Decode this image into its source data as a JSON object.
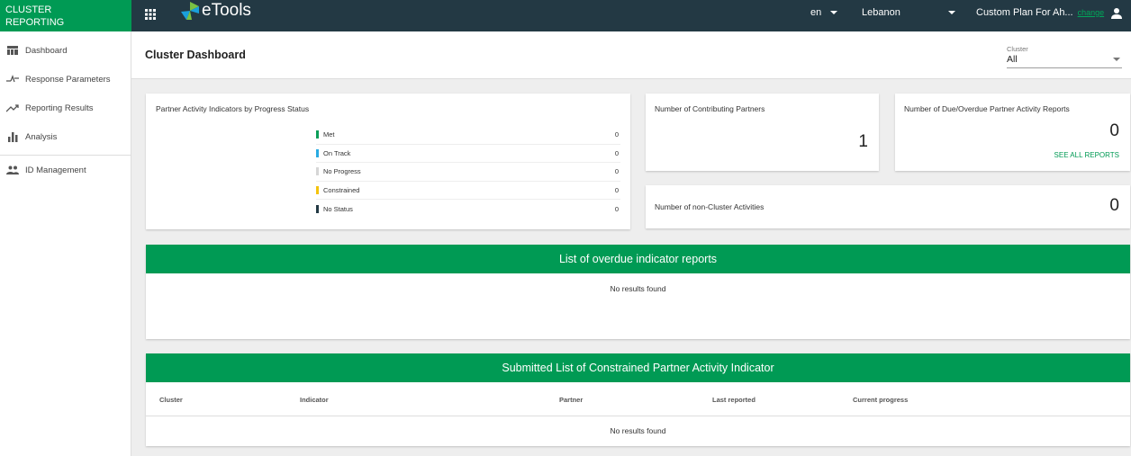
{
  "brand": {
    "line1": "CLUSTER",
    "line2": "REPORTING"
  },
  "topbar": {
    "logo_text": "eTools",
    "language": "en",
    "country": "Lebanon",
    "plan": "Custom Plan For Ah...",
    "change_link": "change",
    "icons": {
      "apps": "apps-grid-icon",
      "user": "user-icon"
    }
  },
  "sidebar": {
    "items": [
      {
        "label": "Dashboard",
        "icon": "dashboard-icon"
      },
      {
        "label": "Response Parameters",
        "icon": "response-parameters-icon"
      },
      {
        "label": "Reporting Results",
        "icon": "trending-up-icon"
      },
      {
        "label": "Analysis",
        "icon": "bar-chart-icon"
      },
      {
        "label": "ID Management",
        "icon": "people-icon"
      }
    ]
  },
  "header": {
    "title": "Cluster Dashboard",
    "cluster_label": "Cluster",
    "cluster_value": "All"
  },
  "progress_card": {
    "title": "Partner Activity Indicators by Progress Status",
    "statuses": [
      {
        "label": "Met",
        "count": "0",
        "color": "#0a9e58"
      },
      {
        "label": "On Track",
        "count": "0",
        "color": "#29abe2"
      },
      {
        "label": "No Progress",
        "count": "0",
        "color": "#d6d6d6"
      },
      {
        "label": "Constrained",
        "count": "0",
        "color": "#f4c30c"
      },
      {
        "label": "No Status",
        "count": "0",
        "color": "#233944"
      }
    ]
  },
  "contributing_card": {
    "title": "Number of Contributing Partners",
    "value": "1"
  },
  "due_card": {
    "title": "Number of Due/Overdue Partner Activity Reports",
    "value": "0",
    "link": "SEE ALL REPORTS"
  },
  "noncluster_card": {
    "title": "Number of non-Cluster Activities",
    "value": "0"
  },
  "overdue_list": {
    "title": "List of overdue indicator reports",
    "empty": "No results found"
  },
  "constrained_list": {
    "title": "Submitted List of Constrained Partner Activity Indicator",
    "columns": [
      "Cluster",
      "Indicator",
      "Partner",
      "Last reported",
      "Current progress"
    ],
    "empty": "No results found"
  },
  "colors": {
    "brand_green": "#009a54",
    "topbar": "#233944"
  }
}
